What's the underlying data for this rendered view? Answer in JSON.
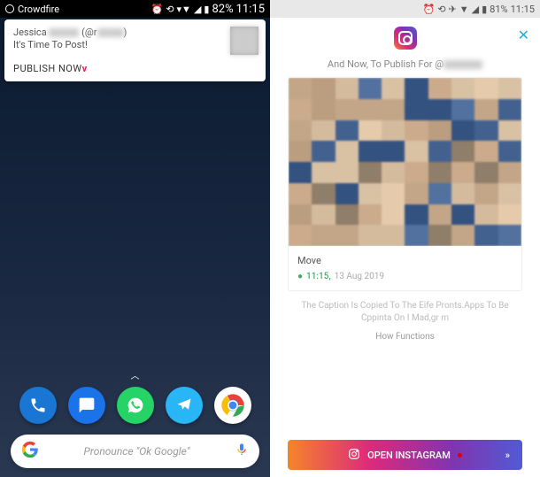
{
  "left": {
    "status": {
      "app_name": "Crowdfire",
      "battery": "82%",
      "time": "11:15"
    },
    "notification": {
      "name": "Jessica",
      "handle_prefix": "(@r",
      "handle_suffix": ")",
      "subtitle": "It's Time To Post!",
      "action": "PUBLISH NOW",
      "action_suffix": "v"
    },
    "search": {
      "placeholder": "Pronounce \"Ok Google\""
    },
    "dock_icons": [
      "phone-icon",
      "messages-icon",
      "whatsapp-icon",
      "telegram-icon",
      "chrome-icon"
    ]
  },
  "right": {
    "status": {
      "battery": "81%",
      "time": "11:15"
    },
    "subtitle_pre": "And Now, To Publish For  @",
    "card": {
      "title": "Move",
      "time": "11:15,",
      "date": "13 Aug 2019"
    },
    "caption": "The Caption Is Copied To The Eife Pronts.Apps To Be Cppinta On I Mad,gr m",
    "how": "How Functions",
    "button": "OPEN INSTAGRAM"
  }
}
